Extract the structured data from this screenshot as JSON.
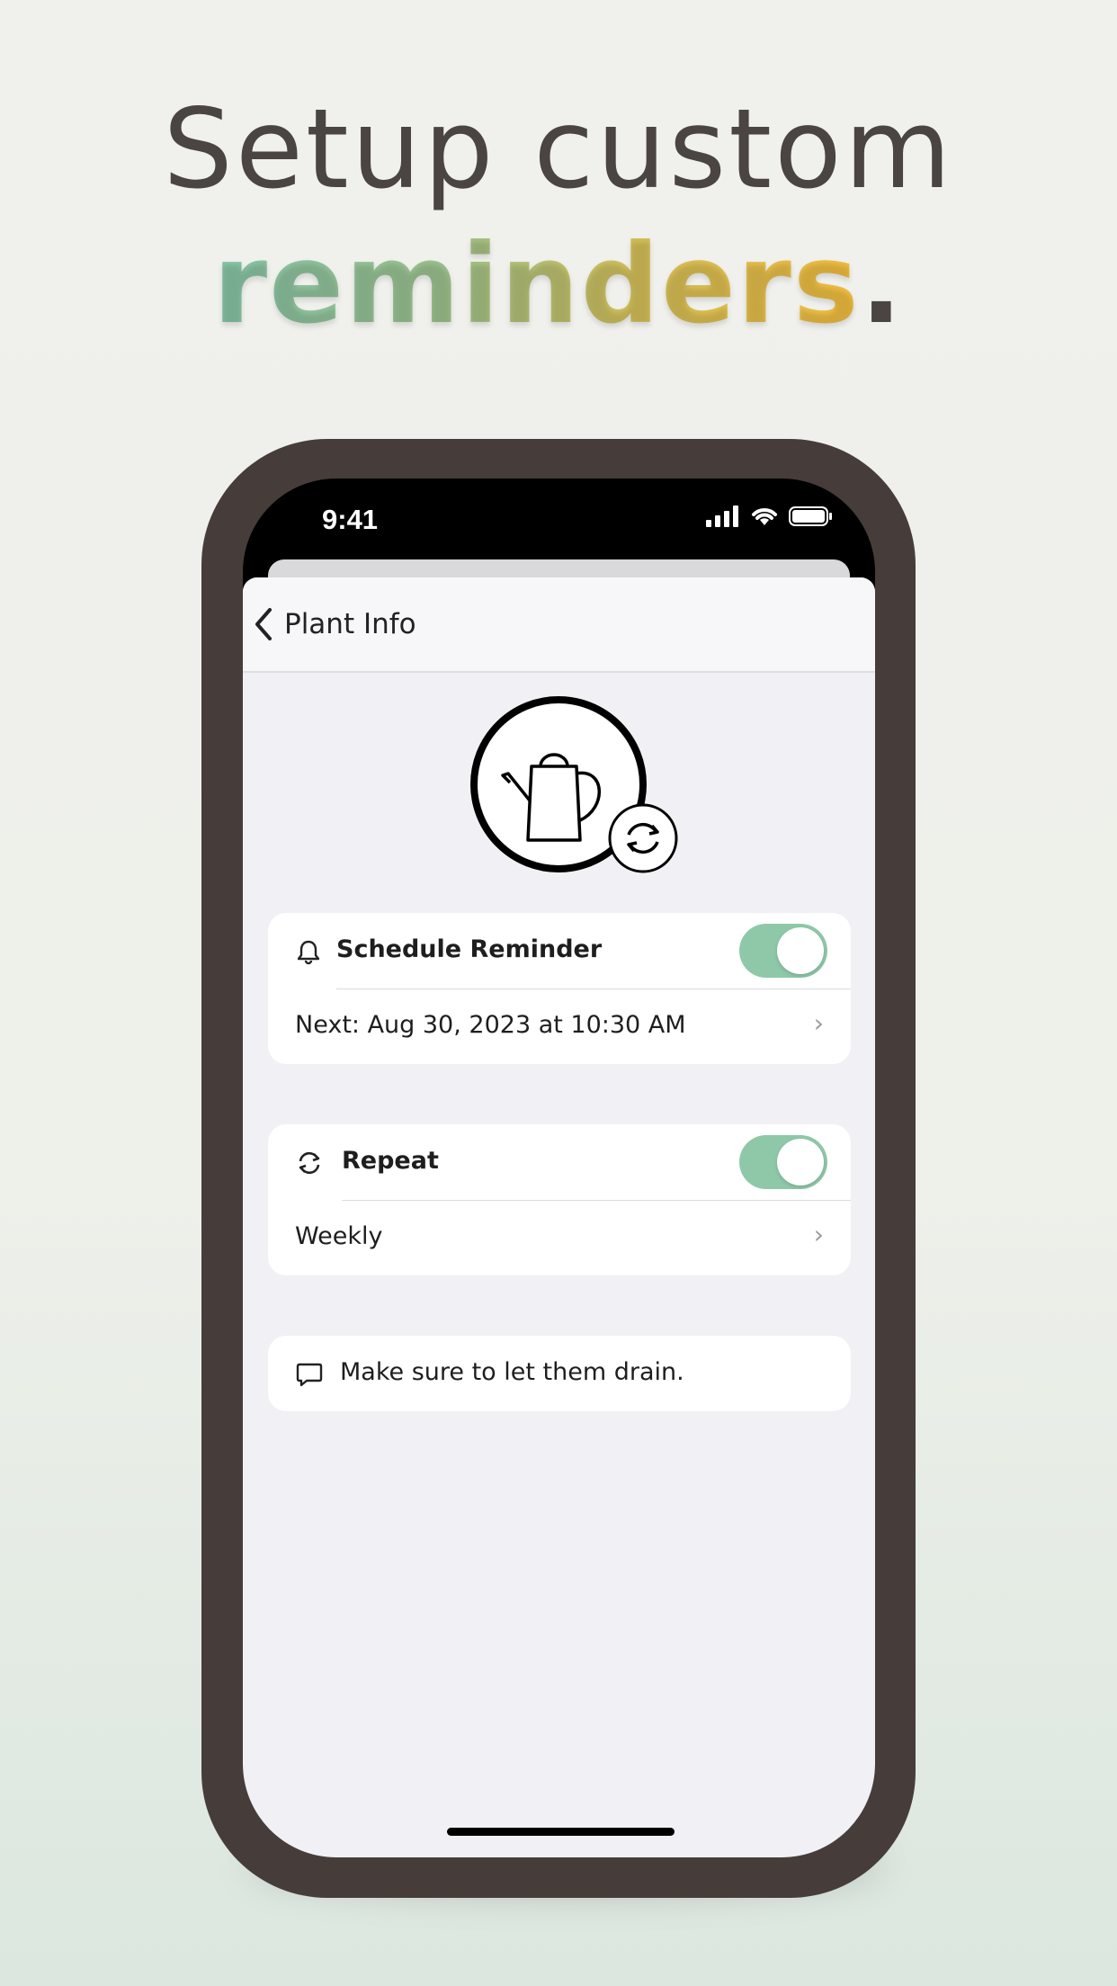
{
  "headline": {
    "line1": "Setup custom",
    "line2": "reminders",
    "line2_suffix": "."
  },
  "status_bar": {
    "time": "9:41",
    "icons": [
      "signal-icon",
      "wifi-icon",
      "battery-icon"
    ]
  },
  "nav": {
    "back_label": "Plant Info"
  },
  "plant": {
    "icon": "watering-can-icon",
    "badge_icon": "refresh-icon"
  },
  "schedule": {
    "icon": "bell-icon",
    "title": "Schedule Reminder",
    "enabled": true,
    "next_label": "Next: Aug 30, 2023 at 10:30 AM"
  },
  "repeat": {
    "icon": "repeat-icon",
    "title": "Repeat",
    "enabled": true,
    "value": "Weekly"
  },
  "note": {
    "icon": "comment-icon",
    "text": "Make sure to let them drain."
  },
  "colors": {
    "toggle_on": "#8fc8a9",
    "frame": "#463d3a",
    "text_dark": "#4a4542"
  }
}
